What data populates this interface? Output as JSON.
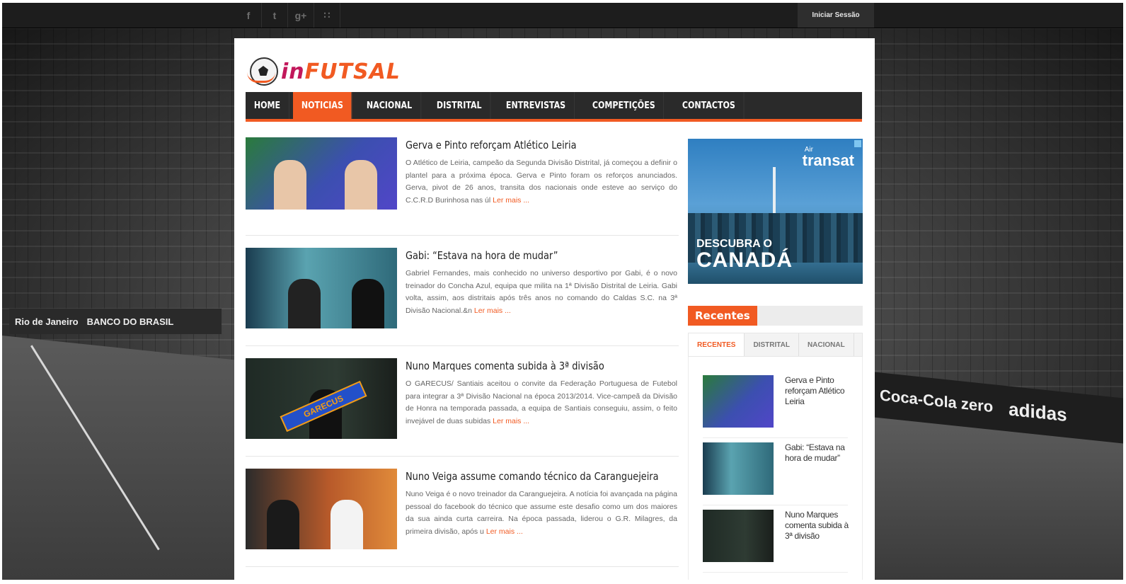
{
  "topbar": {
    "social": [
      {
        "icon": "facebook-icon",
        "glyph": "f"
      },
      {
        "icon": "twitter-icon",
        "glyph": "t"
      },
      {
        "icon": "google-plus-icon",
        "glyph": "g+"
      },
      {
        "icon": "rss-icon",
        "glyph": "∷"
      }
    ],
    "login_label": "Iniciar Sessão"
  },
  "logo": {
    "text_in": "in",
    "text_main": "FUTSAL"
  },
  "nav": {
    "items": [
      "HOME",
      "NOTICIAS",
      "NACIONAL",
      "DISTRITAL",
      "ENTREVISTAS",
      "COMPETIÇÕES",
      "CONTACTOS"
    ],
    "active_index": 1
  },
  "articles": [
    {
      "title": "Gerva e Pinto reforçam Atlético Leiria",
      "text": "O Atlético de Leiria, campeão da Segunda Divisão Distrital, já começou a definir o plantel para a próxima época. Gerva e Pinto foram os reforços anunciados. Gerva, pivot de 26 anos, transita dos nacionais onde esteve ao serviço do C.C.R.D Burinhosa nas úl",
      "more": "Ler mais ..."
    },
    {
      "title": "Gabi: “Estava na hora de mudar”",
      "text": "Gabriel Fernandes, mais conhecido no universo desportivo por Gabi, é o novo treinador do Concha Azul, equipa que milita na 1ª Divisão Distrital de Leiria. Gabi volta, assim, aos distritais após três anos no comando do Caldas S.C. na 3ª Divisão Nacional.&n",
      "more": "Ler mais ..."
    },
    {
      "title": "Nuno Marques comenta subida à 3ª divisão",
      "text": "O GARECUS/ Santiais aceitou o convite da Federação Portuguesa de Futebol para integrar a 3ª Divisão Nacional na época 2013/2014. Vice-campeã da Divisão de Honra na temporada passada, a equipa de Santiais conseguiu, assim, o feito invejável de duas subidas",
      "more": "Ler mais ..."
    },
    {
      "title": "Nuno Veiga assume comando técnico da Caranguejeira",
      "text": "Nuno Veiga é o novo treinador da Caranguejeira. A notícia foi avançada na página pessoal do facebook do técnico que assume este desafio como um dos maiores da sua ainda curta carreira. Na época passada, liderou o G.R. Milagres, da primeira divisão, após u",
      "more": "Ler mais ..."
    }
  ],
  "ad": {
    "brand_small": "Air",
    "brand": "transat",
    "line1": "DESCUBRA O",
    "line2": "CANADÁ"
  },
  "sidebar": {
    "widget_title": "Recentes",
    "tabs": [
      "RECENTES",
      "DISTRITAL",
      "NACIONAL"
    ],
    "recent": [
      {
        "title": "Gerva e Pinto reforçam Atlético Leiria"
      },
      {
        "title": "Gabi: “Estava na hora de mudar”"
      },
      {
        "title": "Nuno Marques comenta subida à 3ª divisão"
      }
    ]
  },
  "background": {
    "banner_left_1": "Rio de Janeiro",
    "banner_left_2": "BANCO DO BRASIL",
    "banner_right_1": "Coca-Cola zero",
    "banner_right_2": "adidas"
  },
  "colors": {
    "accent": "#f15a22",
    "nav_bg": "#2a2a2a",
    "topbar_bg": "#1d1d1d"
  }
}
